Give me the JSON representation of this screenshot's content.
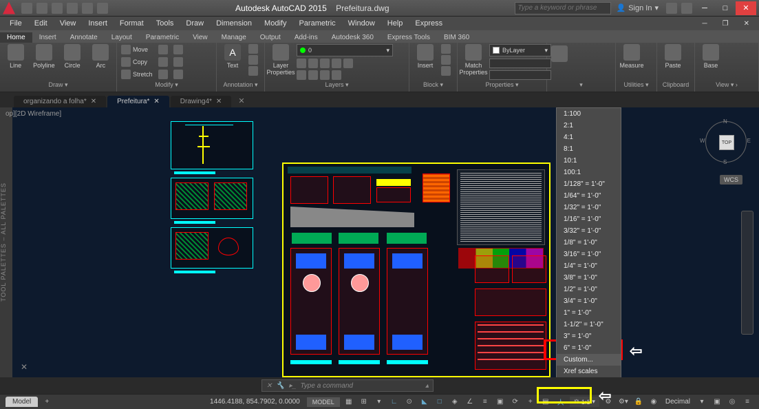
{
  "title": {
    "app": "Autodesk AutoCAD 2015",
    "file": "Prefeitura.dwg"
  },
  "search_placeholder": "Type a keyword or phrase",
  "signin": "Sign In",
  "menubar": [
    "File",
    "Edit",
    "View",
    "Insert",
    "Format",
    "Tools",
    "Draw",
    "Dimension",
    "Modify",
    "Parametric",
    "Window",
    "Help",
    "Express"
  ],
  "ribbon_tabs": [
    "Home",
    "Insert",
    "Annotate",
    "Layout",
    "Parametric",
    "View",
    "Manage",
    "Output",
    "Add-ins",
    "Autodesk 360",
    "Express Tools",
    "BIM 360"
  ],
  "ribbon": {
    "draw": {
      "title": "Draw ▾",
      "items": [
        "Line",
        "Polyline",
        "Circle",
        "Arc"
      ]
    },
    "modify": {
      "title": "Modify ▾",
      "move": "Move",
      "copy": "Copy",
      "stretch": "Stretch"
    },
    "annotation": {
      "title": "Annotation ▾",
      "text": "Text"
    },
    "layers": {
      "title": "Layers ▾",
      "props": "Layer\nProperties",
      "selected": "0"
    },
    "block": {
      "title": "Block ▾",
      "insert": "Insert"
    },
    "properties": {
      "title": "Properties ▾",
      "match": "Match\nProperties",
      "bylayer": "ByLayer"
    },
    "utilities": {
      "title": "Utilities ▾",
      "measure": "Measure"
    },
    "clipboard": {
      "title": "Clipboard",
      "paste": "Paste"
    },
    "view": {
      "title": "View ▾ ›",
      "base": "Base"
    }
  },
  "file_tabs": [
    {
      "label": "organizando a folha*",
      "active": false
    },
    {
      "label": "Prefeitura*",
      "active": true
    },
    {
      "label": "Drawing4*",
      "active": false
    }
  ],
  "viewport_label": "op][2D Wireframe]",
  "tool_palette_label": "TOOL PALETTES – ALL PALETTES",
  "viewcube": {
    "top": "TOP",
    "n": "N",
    "s": "S",
    "e": "E",
    "w": "W"
  },
  "wcs": "WCS",
  "scale_menu": [
    "1:100",
    "2:1",
    "4:1",
    "8:1",
    "10:1",
    "100:1",
    "1/128\" = 1'-0\"",
    "1/64\" = 1'-0\"",
    "1/32\" = 1'-0\"",
    "1/16\" = 1'-0\"",
    "3/32\" = 1'-0\"",
    "1/8\" = 1'-0\"",
    "3/16\" = 1'-0\"",
    "1/4\" = 1'-0\"",
    "3/8\" = 1'-0\"",
    "1/2\" = 1'-0\"",
    "3/4\" = 1'-0\"",
    "1\" = 1'-0\"",
    "1-1/2\" = 1'-0\"",
    "3\" = 1'-0\"",
    "6\" = 1'-0\"",
    "Custom...",
    "Xref scales"
  ],
  "scale_menu_highlight": 21,
  "cmdline_placeholder": "Type a command",
  "status": {
    "tab": "Model",
    "coords": "1446.4188, 854.7902, 0.0000",
    "space": "MODEL",
    "scale": "1:1",
    "units": "Decimal"
  }
}
